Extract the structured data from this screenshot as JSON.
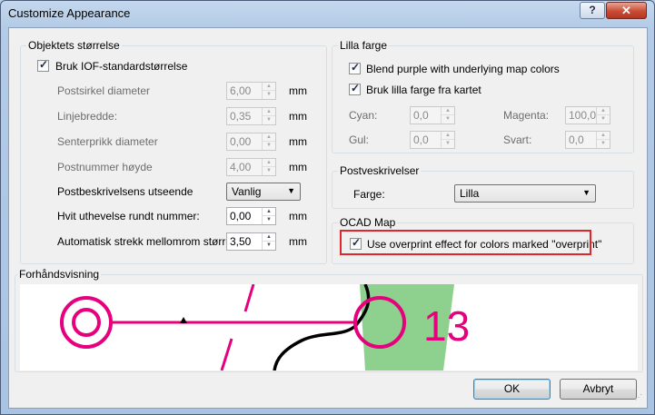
{
  "window": {
    "title": "Customize Appearance",
    "help_label": "?",
    "close_label": "✕"
  },
  "group_size": {
    "title": "Objektets størrelse",
    "use_iof_label": "Bruk IOF-standardstørrelse",
    "rows": [
      {
        "label": "Postsirkel diameter",
        "value": "6,00",
        "unit": "mm"
      },
      {
        "label": "Linjebredde:",
        "value": "0,35",
        "unit": "mm"
      },
      {
        "label": "Senterprikk diameter",
        "value": "0,00",
        "unit": "mm"
      },
      {
        "label": "Postnummer høyde",
        "value": "4,00",
        "unit": "mm"
      }
    ],
    "description_style_label": "Postbeskrivelsens utseende",
    "description_style_value": "Vanlig",
    "white_outline_label": "Hvit uthevelse rundt nummer:",
    "white_outline_value": "0,00",
    "white_outline_unit": "mm",
    "auto_gap_label": "Automatisk strekk mellomrom størrelse:",
    "auto_gap_value": "3,50",
    "auto_gap_unit": "mm"
  },
  "group_purple": {
    "title": "Lilla farge",
    "blend_label": "Blend purple with underlying map colors",
    "use_map_purple_label": "Bruk lilla farge fra kartet",
    "cyan_label": "Cyan:",
    "cyan_value": "0,0",
    "magenta_label": "Magenta:",
    "magenta_value": "100,0",
    "yellow_label": "Gul:",
    "yellow_value": "0,0",
    "black_label": "Svart:",
    "black_value": "0,0"
  },
  "group_descriptions": {
    "title": "Postveskrivelser",
    "color_label": "Farge:",
    "color_value": "Lilla"
  },
  "group_ocad": {
    "title": "OCAD Map",
    "overprint_label": "Use overprint effect for colors marked \"overprint\""
  },
  "preview": {
    "title": "Forhåndsvisning",
    "control_number": "13"
  },
  "buttons": {
    "ok_label": "OK",
    "cancel_label": "Avbryt"
  },
  "colors": {
    "purple": "#e6007e",
    "green_area": "#8ed08e",
    "highlight": "#e0262c"
  }
}
